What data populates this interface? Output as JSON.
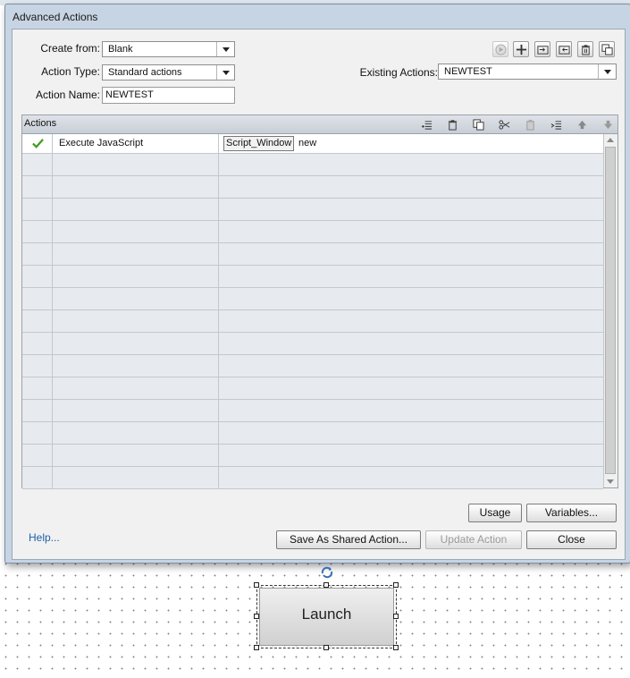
{
  "dialog": {
    "title": "Advanced Actions",
    "create_from": {
      "label": "Create from:",
      "value": "Blank"
    },
    "action_type": {
      "label": "Action Type:",
      "value": "Standard actions"
    },
    "action_name": {
      "label": "Action Name:",
      "value": "NEWTEST"
    },
    "existing_actions": {
      "label": "Existing Actions:",
      "value": "NEWTEST"
    },
    "top_toolbar_icons": [
      "preview-icon",
      "add-icon",
      "import-icon",
      "export-icon",
      "delete-icon",
      "duplicate-icon"
    ],
    "grid": {
      "title": "Actions",
      "toolbar_icons": [
        "insert-row-icon",
        "delete-row-icon",
        "copy-icon",
        "cut-icon",
        "paste-icon",
        "indent-icon",
        "move-up-icon",
        "move-down-icon"
      ],
      "first_row": {
        "status": "check-icon",
        "action": "Execute JavaScript",
        "param_button": "Script_Window",
        "param_value": "new"
      },
      "empty_rows": 15
    },
    "buttons": {
      "usage": "Usage",
      "variables": "Variables...",
      "save_shared": "Save As Shared Action...",
      "update": "Update Action",
      "close": "Close",
      "help": "Help..."
    }
  },
  "stage": {
    "launch_button": "Launch"
  }
}
